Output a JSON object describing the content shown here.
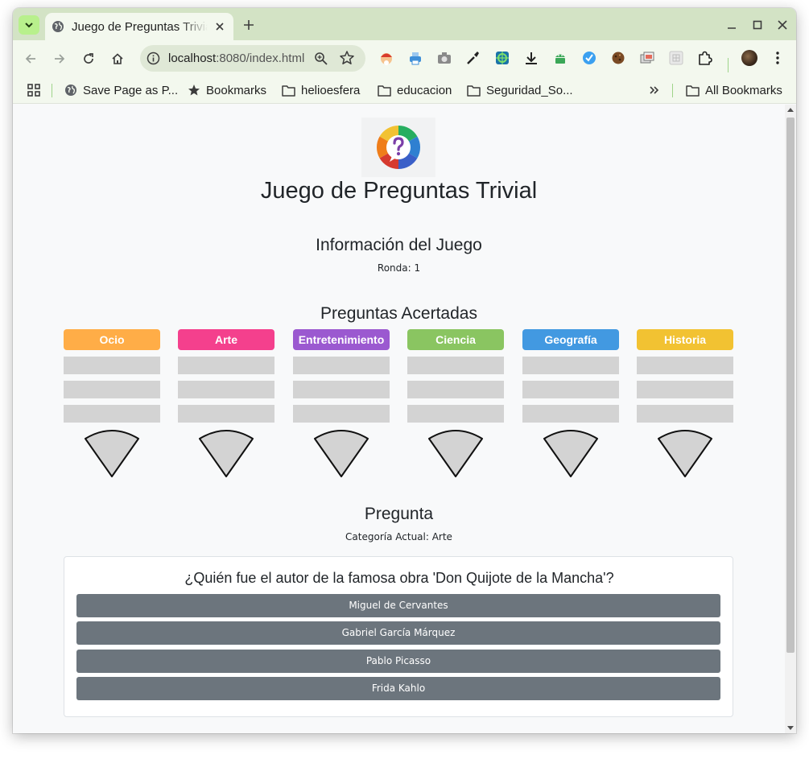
{
  "browser": {
    "tab_title": "Juego de Preguntas Trivial",
    "url_host": "localhost",
    "url_rest": ":8080/index.html",
    "bookmarks": [
      {
        "label": "Save Page as P...",
        "icon": "globe-icon"
      },
      {
        "label": "Bookmarks",
        "icon": "star-icon"
      },
      {
        "label": "helioesfera",
        "icon": "folder-icon"
      },
      {
        "label": "educacion",
        "icon": "folder-icon"
      },
      {
        "label": "Seguridad_So...",
        "icon": "folder-icon"
      }
    ],
    "all_bookmarks_label": "All Bookmarks"
  },
  "page": {
    "title": "Juego de Preguntas Trivial",
    "info_heading": "Información del Juego",
    "round_text": "Ronda: 1",
    "correct_heading": "Preguntas Acertadas",
    "categories": [
      {
        "name": "Ocio",
        "color": "#ffad47"
      },
      {
        "name": "Arte",
        "color": "#f4408d"
      },
      {
        "name": "Entretenimiento",
        "color": "#9b59d0"
      },
      {
        "name": "Ciencia",
        "color": "#8ac561"
      },
      {
        "name": "Geografía",
        "color": "#4299e1"
      },
      {
        "name": "Historia",
        "color": "#f2c232"
      }
    ],
    "question_heading": "Pregunta",
    "current_category_text": "Categoría Actual: Arte",
    "question": "¿Quién fue el autor de la famosa obra 'Don Quijote de la Mancha'?",
    "answers": [
      "Miguel de Cervantes",
      "Gabriel García Márquez",
      "Pablo Picasso",
      "Frida Kahlo"
    ]
  },
  "colors": {
    "tabstrip": "#d3e3c5",
    "toolbar": "#f3f8ee",
    "slot": "#d3d3d3",
    "answer_button": "#6c757d",
    "page_bg": "#f8f9fa"
  }
}
